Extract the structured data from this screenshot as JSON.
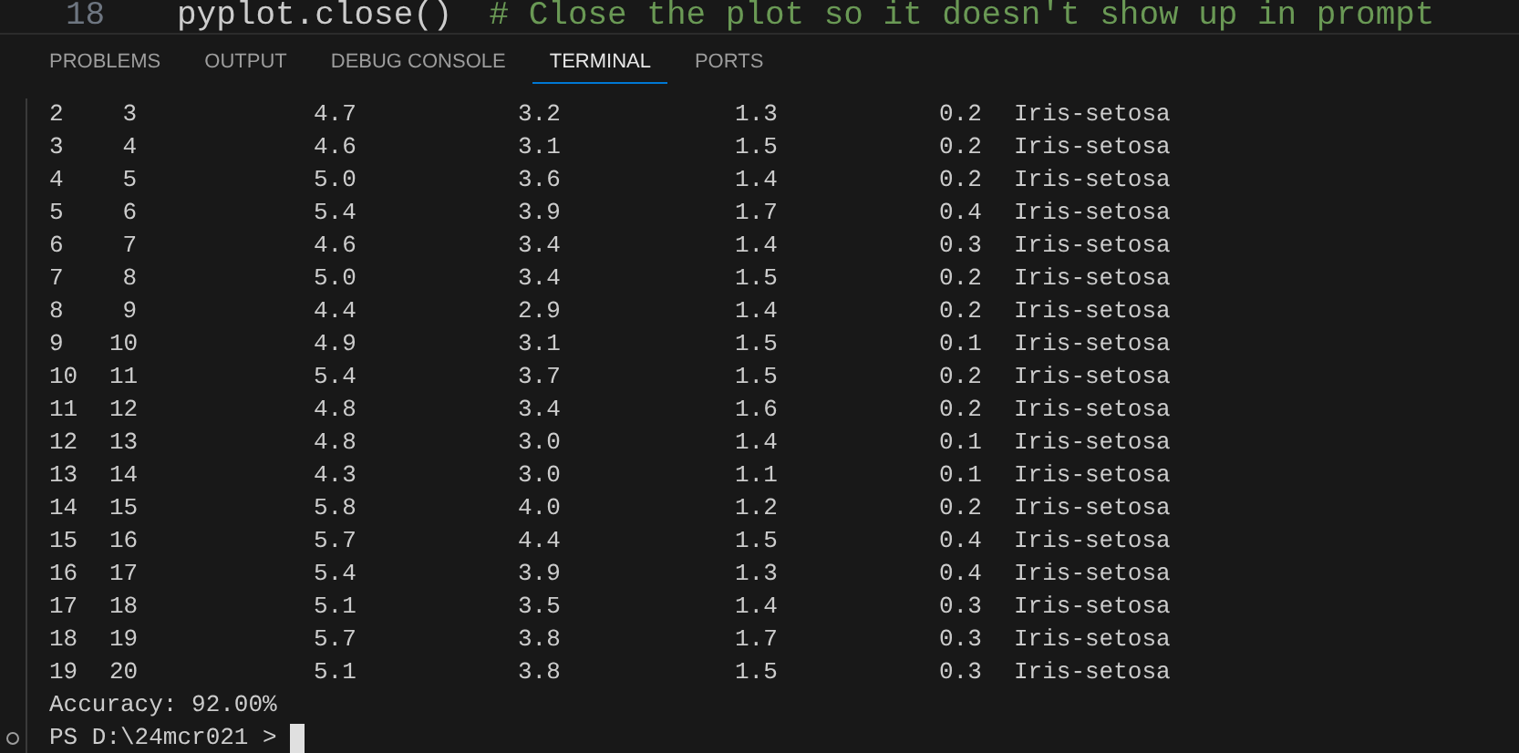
{
  "editor": {
    "line_number": "18",
    "code": "pyplot.close()",
    "comment": "# Close the plot so it doesn't show up in prompt"
  },
  "panel": {
    "tabs": [
      {
        "label": "PROBLEMS",
        "selected": false
      },
      {
        "label": "OUTPUT",
        "selected": false
      },
      {
        "label": "DEBUG CONSOLE",
        "selected": false
      },
      {
        "label": "TERMINAL",
        "selected": true
      },
      {
        "label": "PORTS",
        "selected": false
      }
    ]
  },
  "terminal": {
    "rows": [
      [
        "2",
        "3",
        "4.7",
        "3.2",
        "1.3",
        "0.2",
        "Iris-setosa"
      ],
      [
        "3",
        "4",
        "4.6",
        "3.1",
        "1.5",
        "0.2",
        "Iris-setosa"
      ],
      [
        "4",
        "5",
        "5.0",
        "3.6",
        "1.4",
        "0.2",
        "Iris-setosa"
      ],
      [
        "5",
        "6",
        "5.4",
        "3.9",
        "1.7",
        "0.4",
        "Iris-setosa"
      ],
      [
        "6",
        "7",
        "4.6",
        "3.4",
        "1.4",
        "0.3",
        "Iris-setosa"
      ],
      [
        "7",
        "8",
        "5.0",
        "3.4",
        "1.5",
        "0.2",
        "Iris-setosa"
      ],
      [
        "8",
        "9",
        "4.4",
        "2.9",
        "1.4",
        "0.2",
        "Iris-setosa"
      ],
      [
        "9",
        "10",
        "4.9",
        "3.1",
        "1.5",
        "0.1",
        "Iris-setosa"
      ],
      [
        "10",
        "11",
        "5.4",
        "3.7",
        "1.5",
        "0.2",
        "Iris-setosa"
      ],
      [
        "11",
        "12",
        "4.8",
        "3.4",
        "1.6",
        "0.2",
        "Iris-setosa"
      ],
      [
        "12",
        "13",
        "4.8",
        "3.0",
        "1.4",
        "0.1",
        "Iris-setosa"
      ],
      [
        "13",
        "14",
        "4.3",
        "3.0",
        "1.1",
        "0.1",
        "Iris-setosa"
      ],
      [
        "14",
        "15",
        "5.8",
        "4.0",
        "1.2",
        "0.2",
        "Iris-setosa"
      ],
      [
        "15",
        "16",
        "5.7",
        "4.4",
        "1.5",
        "0.4",
        "Iris-setosa"
      ],
      [
        "16",
        "17",
        "5.4",
        "3.9",
        "1.3",
        "0.4",
        "Iris-setosa"
      ],
      [
        "17",
        "18",
        "5.1",
        "3.5",
        "1.4",
        "0.3",
        "Iris-setosa"
      ],
      [
        "18",
        "19",
        "5.7",
        "3.8",
        "1.7",
        "0.3",
        "Iris-setosa"
      ],
      [
        "19",
        "20",
        "5.1",
        "3.8",
        "1.5",
        "0.3",
        "Iris-setosa"
      ]
    ],
    "output": "Accuracy: 92.00%",
    "prompt": "PS D:\\24mcr021 >"
  }
}
